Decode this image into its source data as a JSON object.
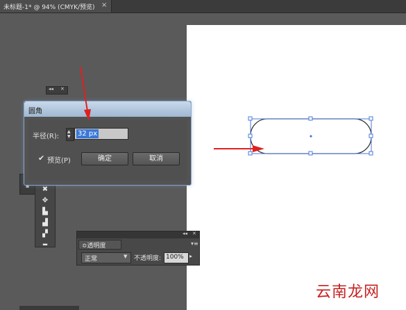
{
  "document_tab": {
    "title": "未标题-1* @ 94% (CMYK/预览)",
    "close": "×"
  },
  "dialog": {
    "title": "圆角",
    "radius_label": "半径(R):",
    "radius_value": "32 px",
    "preview_check": "✔",
    "preview_label": "预览(P)",
    "ok_label": "确定",
    "cancel_label": "取消"
  },
  "mini_panel": {
    "collapse": "◂◂",
    "close": "✕"
  },
  "transparency_panel": {
    "collapse": "◂◂",
    "close": "✕",
    "tab_label": "≎透明度",
    "menu": "▾≡",
    "blend_mode": "正常",
    "opacity_label": "不透明度:",
    "opacity_value": "100%"
  },
  "watermark": "云南龙网",
  "colors": {
    "annotation_arrow": "#e02020",
    "selection": "#4a78d8",
    "dialog_title_bg": "#b4c8de"
  },
  "tools": [
    "free-transform-icon",
    "perspective-icon",
    "symbol-sprayer-icon",
    "graph-icon",
    "artboard-icon",
    "slice-icon"
  ]
}
